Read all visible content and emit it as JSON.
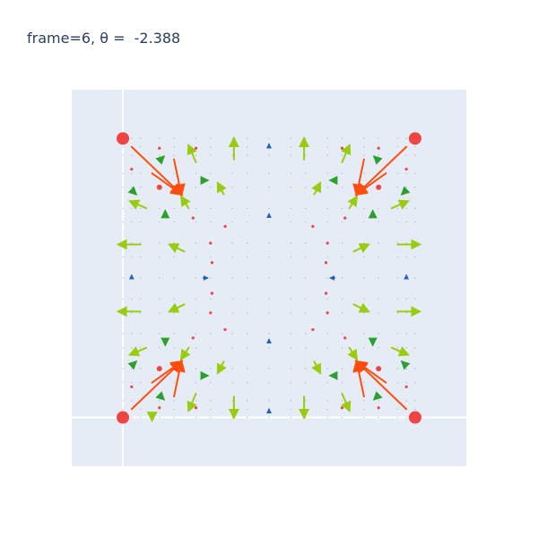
{
  "chart_data": {
    "type": "scatter",
    "title": "frame=6, θ =  -2.388",
    "xlabel": "",
    "ylabel": "",
    "xlim": [
      -0.35,
      2.35
    ],
    "ylim": [
      -0.35,
      2.35
    ],
    "grid": false,
    "zero_lines": true,
    "colors": {
      "plot_bg": "#e5ecf6",
      "zero_line": "#ffffff",
      "point": "#ef4444",
      "big_arrow": "#ff4d0f",
      "mid_arrow": "#99cc11",
      "small_arrow": "#2ca02c",
      "tiny_arrow": "#1f5fbf",
      "dot": "#7f7f7f"
    },
    "series": [
      {
        "kind": "scatter",
        "points": [
          [
            0,
            0
          ],
          [
            2,
            0
          ],
          [
            0,
            2
          ],
          [
            2,
            2
          ],
          [
            0.25,
            1.65
          ],
          [
            1.75,
            1.65
          ],
          [
            0.25,
            0.35
          ],
          [
            1.75,
            0.35
          ]
        ]
      }
    ],
    "arrows": [
      {
        "tier": "big",
        "items": [
          [
            0.06,
            1.94,
            0.4,
            1.6
          ],
          [
            0.2,
            1.75,
            0.4,
            1.6
          ],
          [
            0.35,
            1.85,
            0.4,
            1.6
          ],
          [
            1.94,
            1.94,
            1.6,
            1.6
          ],
          [
            1.8,
            1.75,
            1.6,
            1.6
          ],
          [
            1.65,
            1.85,
            1.6,
            1.6
          ],
          [
            0.06,
            0.06,
            0.4,
            0.4
          ],
          [
            0.2,
            0.25,
            0.4,
            0.4
          ],
          [
            0.35,
            0.15,
            0.4,
            0.4
          ],
          [
            1.94,
            0.06,
            1.6,
            0.4
          ],
          [
            1.8,
            0.25,
            1.6,
            0.4
          ],
          [
            1.65,
            0.15,
            1.6,
            0.4
          ]
        ]
      },
      {
        "tier": "mid",
        "items": [
          [
            0.5,
            1.83,
            0.45,
            1.95
          ],
          [
            0.76,
            1.85,
            0.76,
            2.0
          ],
          [
            1.24,
            1.85,
            1.24,
            2.0
          ],
          [
            1.5,
            1.83,
            1.55,
            1.95
          ],
          [
            0.16,
            1.5,
            0.05,
            1.55
          ],
          [
            1.84,
            1.5,
            1.95,
            1.55
          ],
          [
            0.12,
            1.24,
            -0.03,
            1.24
          ],
          [
            1.88,
            1.24,
            2.03,
            1.24
          ],
          [
            0.12,
            0.76,
            -0.03,
            0.76
          ],
          [
            1.88,
            0.76,
            2.03,
            0.76
          ],
          [
            0.16,
            0.5,
            0.05,
            0.45
          ],
          [
            1.84,
            0.5,
            1.95,
            0.45
          ],
          [
            0.5,
            0.17,
            0.45,
            0.05
          ],
          [
            1.5,
            0.17,
            1.55,
            0.05
          ],
          [
            0.76,
            0.15,
            0.76,
            0.0
          ],
          [
            1.24,
            0.15,
            1.24,
            0.0
          ],
          [
            0.45,
            1.5,
            0.4,
            1.58
          ],
          [
            1.55,
            1.5,
            1.6,
            1.58
          ],
          [
            0.45,
            0.5,
            0.4,
            0.42
          ],
          [
            1.55,
            0.5,
            1.6,
            0.42
          ],
          [
            0.69,
            1.6,
            0.65,
            1.68
          ],
          [
            1.31,
            1.6,
            1.35,
            1.68
          ],
          [
            0.69,
            0.4,
            0.65,
            0.32
          ],
          [
            1.31,
            0.4,
            1.35,
            0.32
          ],
          [
            0.42,
            1.19,
            0.32,
            1.24
          ],
          [
            1.58,
            1.19,
            1.68,
            1.24
          ],
          [
            0.42,
            0.81,
            0.32,
            0.76
          ],
          [
            1.58,
            0.81,
            1.68,
            0.76
          ],
          [
            0.2,
            0.0,
            0.2,
            -0.02
          ]
        ]
      },
      {
        "tier": "small",
        "items": [
          [
            0.25,
            1.84,
            0.28,
            1.87
          ],
          [
            1.75,
            1.84,
            1.72,
            1.87
          ],
          [
            0.25,
            0.16,
            0.28,
            0.13
          ],
          [
            1.75,
            0.16,
            1.72,
            0.13
          ],
          [
            0.06,
            1.63,
            0.09,
            1.6
          ],
          [
            1.94,
            1.63,
            1.91,
            1.6
          ],
          [
            0.06,
            0.37,
            0.09,
            0.4
          ],
          [
            1.94,
            0.37,
            1.91,
            0.4
          ],
          [
            0.29,
            1.44,
            0.29,
            1.48
          ],
          [
            1.71,
            1.44,
            1.71,
            1.48
          ],
          [
            0.29,
            0.56,
            0.29,
            0.52
          ],
          [
            1.71,
            0.56,
            1.71,
            0.52
          ],
          [
            0.55,
            1.7,
            0.58,
            1.7
          ],
          [
            1.45,
            1.7,
            1.42,
            1.7
          ],
          [
            0.55,
            0.3,
            0.58,
            0.3
          ],
          [
            1.45,
            0.3,
            1.42,
            0.3
          ]
        ]
      },
      {
        "tier": "tiny",
        "items": [
          [
            0.06,
            1.0,
            0.06,
            1.02
          ],
          [
            1.94,
            1.0,
            1.94,
            1.02
          ],
          [
            0.55,
            1.0,
            0.58,
            1.0
          ],
          [
            1.45,
            1.0,
            1.42,
            1.0
          ],
          [
            1.0,
            1.45,
            1.0,
            1.46
          ],
          [
            1.0,
            0.55,
            1.0,
            0.56
          ],
          [
            1.0,
            1.95,
            1.0,
            1.96
          ],
          [
            1.0,
            0.05,
            1.0,
            0.06
          ]
        ]
      }
    ],
    "small_points": [
      [
        0.25,
        1.93
      ],
      [
        1.75,
        1.93
      ],
      [
        0.25,
        0.07
      ],
      [
        1.75,
        0.07
      ],
      [
        0.5,
        1.93
      ],
      [
        1.5,
        1.93
      ],
      [
        0.5,
        0.07
      ],
      [
        1.5,
        0.07
      ],
      [
        0.48,
        1.43
      ],
      [
        1.52,
        1.43
      ],
      [
        0.48,
        0.57
      ],
      [
        1.52,
        0.57
      ],
      [
        0.6,
        1.25
      ],
      [
        1.4,
        1.25
      ],
      [
        0.6,
        0.75
      ],
      [
        1.4,
        0.75
      ],
      [
        0.7,
        1.37
      ],
      [
        1.3,
        1.37
      ],
      [
        0.7,
        0.63
      ],
      [
        1.3,
        0.63
      ],
      [
        0.06,
        1.78
      ],
      [
        1.94,
        1.78
      ],
      [
        0.06,
        0.22
      ],
      [
        1.94,
        0.22
      ],
      [
        0.61,
        0.89
      ],
      [
        1.39,
        0.89
      ],
      [
        0.61,
        1.11
      ],
      [
        1.39,
        1.11
      ]
    ],
    "dot_grid": [
      0.0,
      0.06,
      0.12,
      0.25,
      0.35,
      0.5,
      0.6,
      0.75,
      0.85,
      1.0,
      1.15,
      1.25,
      1.4,
      1.5,
      1.65,
      1.75,
      1.88,
      1.94,
      2.0
    ]
  }
}
